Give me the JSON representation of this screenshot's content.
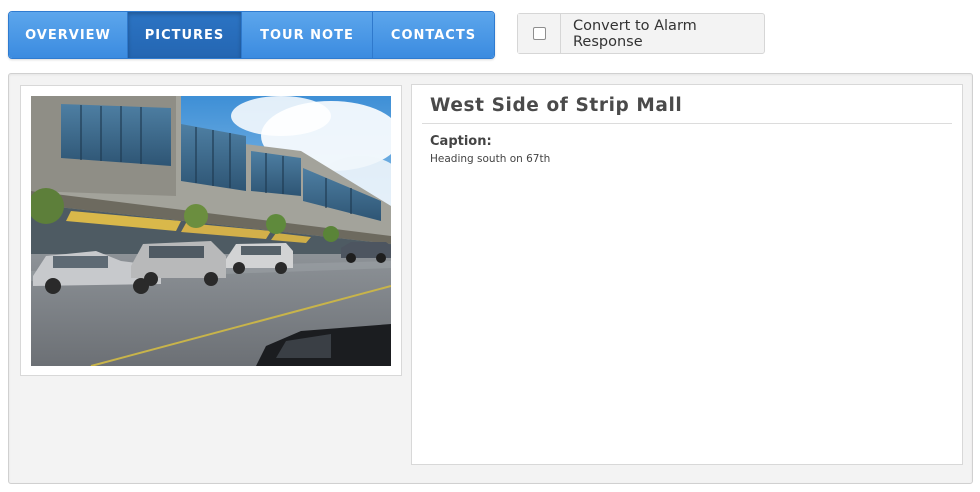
{
  "tabs": [
    {
      "label": "OVERVIEW",
      "active": false
    },
    {
      "label": "PICTURES",
      "active": true
    },
    {
      "label": "TOUR NOTE",
      "active": false
    },
    {
      "label": "CONTACTS",
      "active": false
    }
  ],
  "alarm_toggle": {
    "label": "Convert to Alarm Response",
    "checked": false
  },
  "picture": {
    "title": "West Side of Strip Mall",
    "caption_label": "Caption:",
    "caption_text": "Heading south on 67th"
  },
  "colors": {
    "tab_blue": "#3b8be0",
    "tab_active": "#2466b2",
    "panel_bg": "#f3f3f3"
  }
}
